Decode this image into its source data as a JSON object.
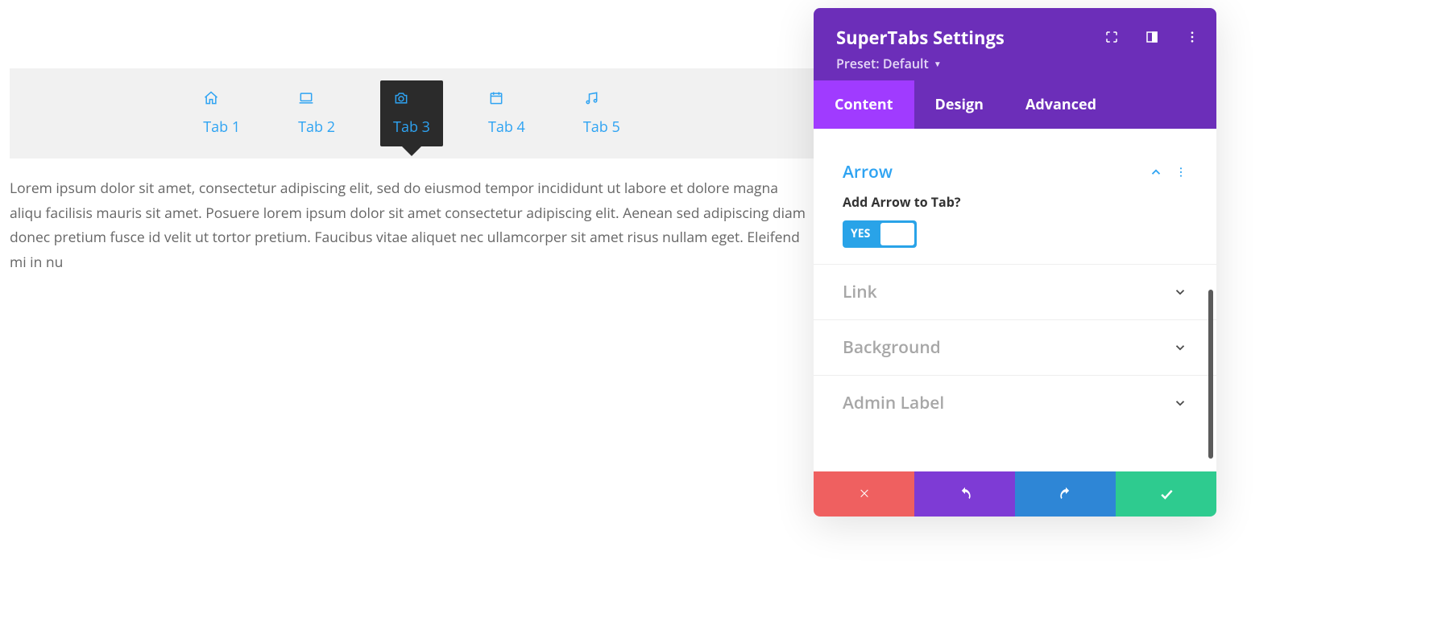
{
  "preview": {
    "tabs": [
      {
        "label": "Tab 1",
        "icon": "home-icon"
      },
      {
        "label": "Tab 2",
        "icon": "laptop-icon"
      },
      {
        "label": "Tab 3",
        "icon": "camera-icon"
      },
      {
        "label": "Tab 4",
        "icon": "calendar-icon"
      },
      {
        "label": "Tab 5",
        "icon": "music-icon"
      }
    ],
    "active_index": 2,
    "body": "Lorem ipsum dolor sit amet, consectetur adipiscing elit, sed do eiusmod tempor incididunt ut labore et dolore magna aliqu facilisis mauris sit amet. Posuere lorem ipsum dolor sit amet consectetur adipiscing elit. Aenean sed adipiscing diam donec pretium fusce id velit ut tortor pretium. Faucibus vitae aliquet nec ullamcorper sit amet risus nullam eget. Eleifend mi in nu"
  },
  "panel": {
    "title": "SuperTabs Settings",
    "preset_label": "Preset: Default",
    "tabs": {
      "content": "Content",
      "design": "Design",
      "advanced": "Advanced"
    },
    "active_tab": "content",
    "sections": {
      "arrow": {
        "title": "Arrow",
        "expanded": true,
        "field_label": "Add Arrow to Tab?",
        "toggle_on_text": "YES",
        "toggle_value": true
      },
      "link": {
        "title": "Link",
        "expanded": false
      },
      "background": {
        "title": "Background",
        "expanded": false
      },
      "admin_label": {
        "title": "Admin Label",
        "expanded": false
      }
    },
    "footer": {
      "cancel": "cancel",
      "undo": "undo",
      "redo": "redo",
      "save": "save"
    }
  }
}
